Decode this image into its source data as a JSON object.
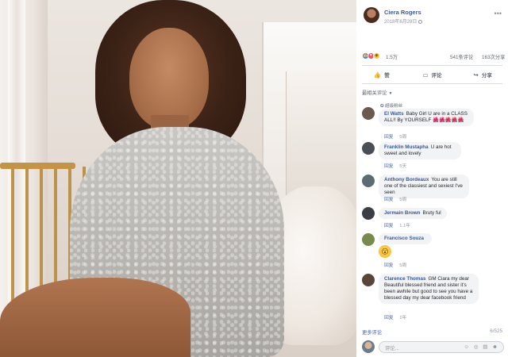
{
  "post": {
    "poster_name": "Ciera Rogers",
    "date": "2018年6月28日",
    "reaction_count": "1.5万",
    "comment_count": "541条评论",
    "share_count": "163次分享"
  },
  "actions": {
    "like": "赞",
    "comment": "评论",
    "share": "分享"
  },
  "sort_label": "最相关评论",
  "comments": [
    {
      "badge": "超级粉丝",
      "name": "El Watts",
      "text": "Baby Girl U are in a CLASS ALL!! By YOURSELF 🌺🌺🌺🌺🌺",
      "reply": "回复",
      "time": "5周",
      "avatar_color": "#6b5a4e"
    },
    {
      "name": "Franklin Mustapha",
      "text": "U are hot sweet and lovely",
      "reply": "回复",
      "time": "5天",
      "avatar_color": "#4a4f57"
    },
    {
      "name": "Anthony Bordeaux",
      "text": "You are still one of the classiest and sexiest I've seen",
      "reply": "回复",
      "time": "5周",
      "avatar_color": "#5d6b73"
    },
    {
      "name": "Jermain Brown",
      "text": "Bruty ful",
      "reply": "回复",
      "time": "1.1年",
      "avatar_color": "#3b3f45"
    },
    {
      "name": "Francisco Souza",
      "emoji": "😮",
      "reply": "回复",
      "time": "5周",
      "avatar_color": "#7a8a4c"
    },
    {
      "name": "Clarence Thomas",
      "text": "GM Ciara my dear Beautiful blessed friend and sister it's been awhile but good to see you have a blessed day my dear facebook friend",
      "reply": "回复",
      "time": "1年",
      "avatar_color": "#5a4638"
    }
  ],
  "more_comments": "更多评论",
  "page_count": "6/525",
  "composer_placeholder": "评论...",
  "composer_tools": "☺ ◎ ▤ ☻"
}
